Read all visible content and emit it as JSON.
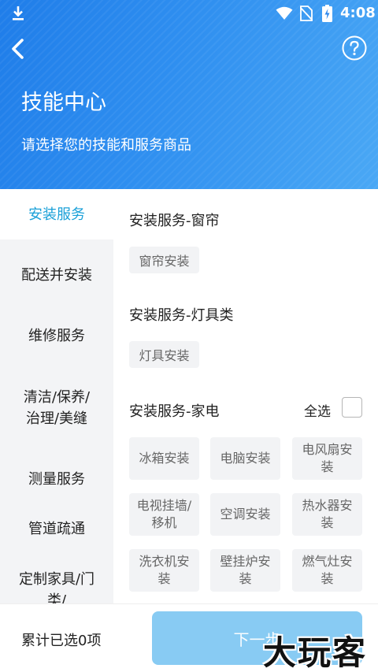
{
  "status_bar": {
    "time": "4:08",
    "icons": [
      "download-icon",
      "wifi-icon",
      "no-sim-icon",
      "battery-charging-icon"
    ]
  },
  "header": {
    "title": "技能中心",
    "subtitle": "请选择您的技能和服务商品",
    "back_icon": "chevron-left-icon",
    "help_icon": "help-circle-icon",
    "colors": {
      "gradient_start": "#1f7de9",
      "gradient_end": "#4aa8f5"
    }
  },
  "sidebar": {
    "active_index": 0,
    "active_color": "#1aa0d8",
    "items": [
      {
        "label": "安装服务"
      },
      {
        "label": "配送并安装"
      },
      {
        "label": "维修服务"
      },
      {
        "label": "清洁/保养/治理/美缝"
      },
      {
        "label": "测量服务"
      },
      {
        "label": "管道疏通"
      },
      {
        "label": "定制家具/门类/"
      }
    ]
  },
  "main": {
    "sections": [
      {
        "title": "安装服务-窗帘",
        "items": [
          "窗帘安装"
        ]
      },
      {
        "title": "安装服务-灯具类",
        "items": [
          "灯具安装"
        ]
      },
      {
        "title": "安装服务-家电",
        "select_all": "全选",
        "select_all_checked": false,
        "items": [
          "冰箱安装",
          "电脑安装",
          "电风扇安装",
          "电视挂墙/移机",
          "空调安装",
          "热水器安装",
          "洗衣机安装",
          "壁挂炉安装",
          "燃气灶安装"
        ]
      }
    ]
  },
  "footer": {
    "selected_count": "累计已选0项",
    "next_label": "下一步",
    "next_color": "#88cbf3"
  },
  "watermark": "大玩客"
}
